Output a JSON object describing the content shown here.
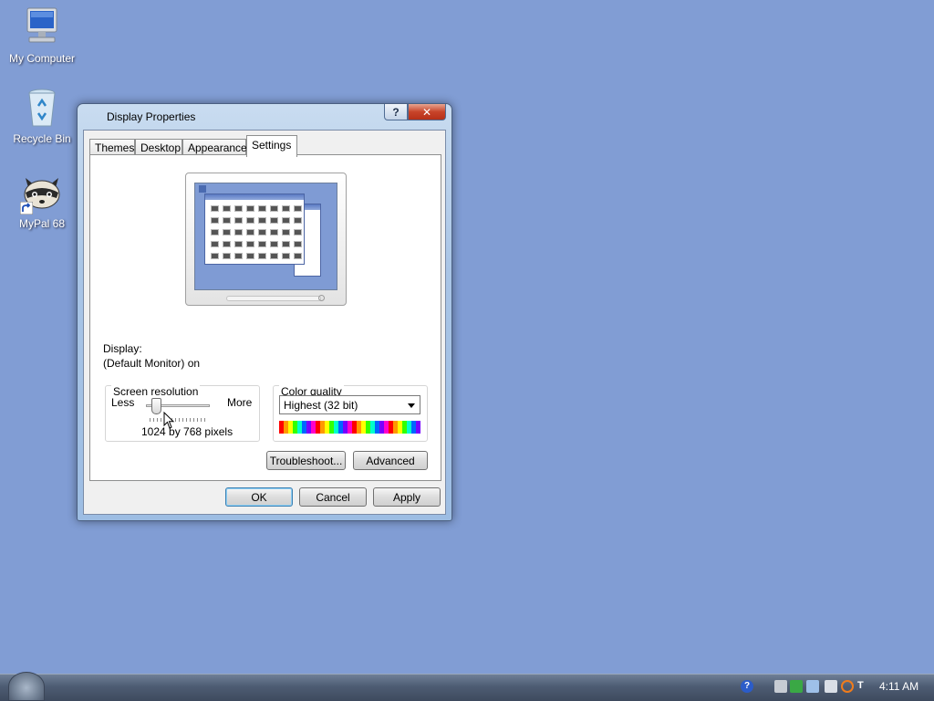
{
  "desktop": {
    "icons": [
      {
        "label": "My Computer"
      },
      {
        "label": "Recycle Bin"
      },
      {
        "label": "MyPal 68"
      }
    ],
    "background_color": "#819dd4"
  },
  "window": {
    "title": "Display Properties",
    "help_label": "?",
    "close_label": "✕",
    "tabs": [
      {
        "label": "Themes",
        "active": false
      },
      {
        "label": "Desktop",
        "active": false
      },
      {
        "label": "Appearance",
        "active": false
      },
      {
        "label": "Settings",
        "active": true
      }
    ],
    "display_label": "Display:",
    "display_value": "(Default Monitor) on",
    "resolution": {
      "group_label": "Screen resolution",
      "less_label": "Less",
      "more_label": "More",
      "value_text": "1024 by 768 pixels",
      "slider_level": 0.1
    },
    "color_quality": {
      "group_label": "Color quality",
      "selected": "Highest (32 bit)"
    },
    "buttons": {
      "troubleshoot": "Troubleshoot...",
      "advanced": "Advanced",
      "ok": "OK",
      "cancel": "Cancel",
      "apply": "Apply"
    }
  },
  "taskbar": {
    "clock": "4:11 AM",
    "tray_icons": [
      "help-icon",
      "network-icon",
      "security-check-icon",
      "volume-icon",
      "monitor-icon",
      "search-icon",
      "language-icon"
    ]
  }
}
